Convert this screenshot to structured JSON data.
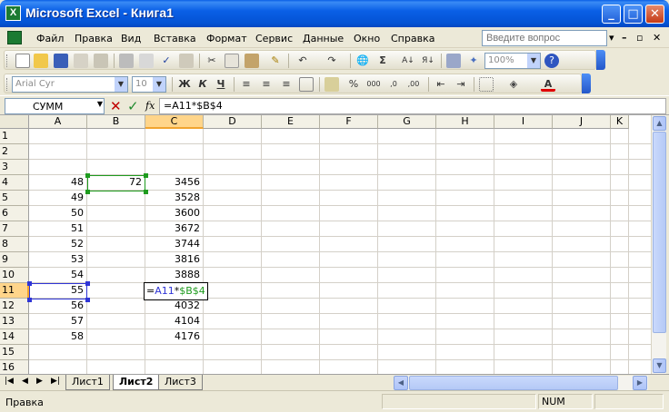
{
  "window": {
    "title": "Microsoft Excel - Книга1",
    "app_icon": "X",
    "controls": {
      "minimize": "_",
      "maximize": "□",
      "close": "✕"
    }
  },
  "menu": {
    "items": [
      "Файл",
      "Правка",
      "Вид",
      "Вставка",
      "Формат",
      "Сервис",
      "Данные",
      "Окно",
      "Справка"
    ],
    "ask_placeholder": "Введите вопрос",
    "doc_controls": {
      "minimize": "–",
      "restore": "▫",
      "close": "✕"
    }
  },
  "toolbar": {
    "zoom": "100%",
    "font_name": "Arial Cyr",
    "font_size": "10",
    "bold_label": "Ж",
    "italic_label": "К",
    "underline_label": "Ч",
    "sum_label": "Σ",
    "percent_label": "%",
    "thousands_label": "000",
    "font_color_label": "A",
    "accent_color": "#e00000"
  },
  "formula_bar": {
    "name_box": "СУММ",
    "fx_label": "fx",
    "formula": "=A11*$B$4"
  },
  "sheet": {
    "columns": [
      "A",
      "B",
      "C",
      "D",
      "E",
      "F",
      "G",
      "H",
      "I",
      "J",
      "K"
    ],
    "rows": [
      "1",
      "2",
      "3",
      "4",
      "5",
      "6",
      "7",
      "8",
      "9",
      "10",
      "11",
      "12",
      "13",
      "14",
      "15",
      "16"
    ],
    "cells": {
      "A4": "48",
      "A5": "49",
      "A6": "50",
      "A7": "51",
      "A8": "52",
      "A9": "53",
      "A10": "54",
      "A11": "55",
      "A12": "56",
      "A13": "57",
      "A14": "58",
      "B4": "72",
      "C4": "3456",
      "C5": "3528",
      "C6": "3600",
      "C7": "3672",
      "C8": "3744",
      "C9": "3816",
      "C10": "3888",
      "C12": "4032",
      "C13": "4104",
      "C14": "4176"
    },
    "editing_cell": "C11",
    "editing_parts": {
      "prefix": "=",
      "ref_a": "A11",
      "op": "*",
      "ref_b": "$B$4"
    },
    "colors": {
      "ref_a": "#2f35d6",
      "ref_b": "#1e9b1e",
      "selected_header": "#ffd58a"
    }
  },
  "tabs": {
    "sheets": [
      "Лист1",
      "Лист2",
      "Лист3"
    ],
    "active": "Лист2"
  },
  "status": {
    "mode": "Правка",
    "num": "NUM"
  }
}
